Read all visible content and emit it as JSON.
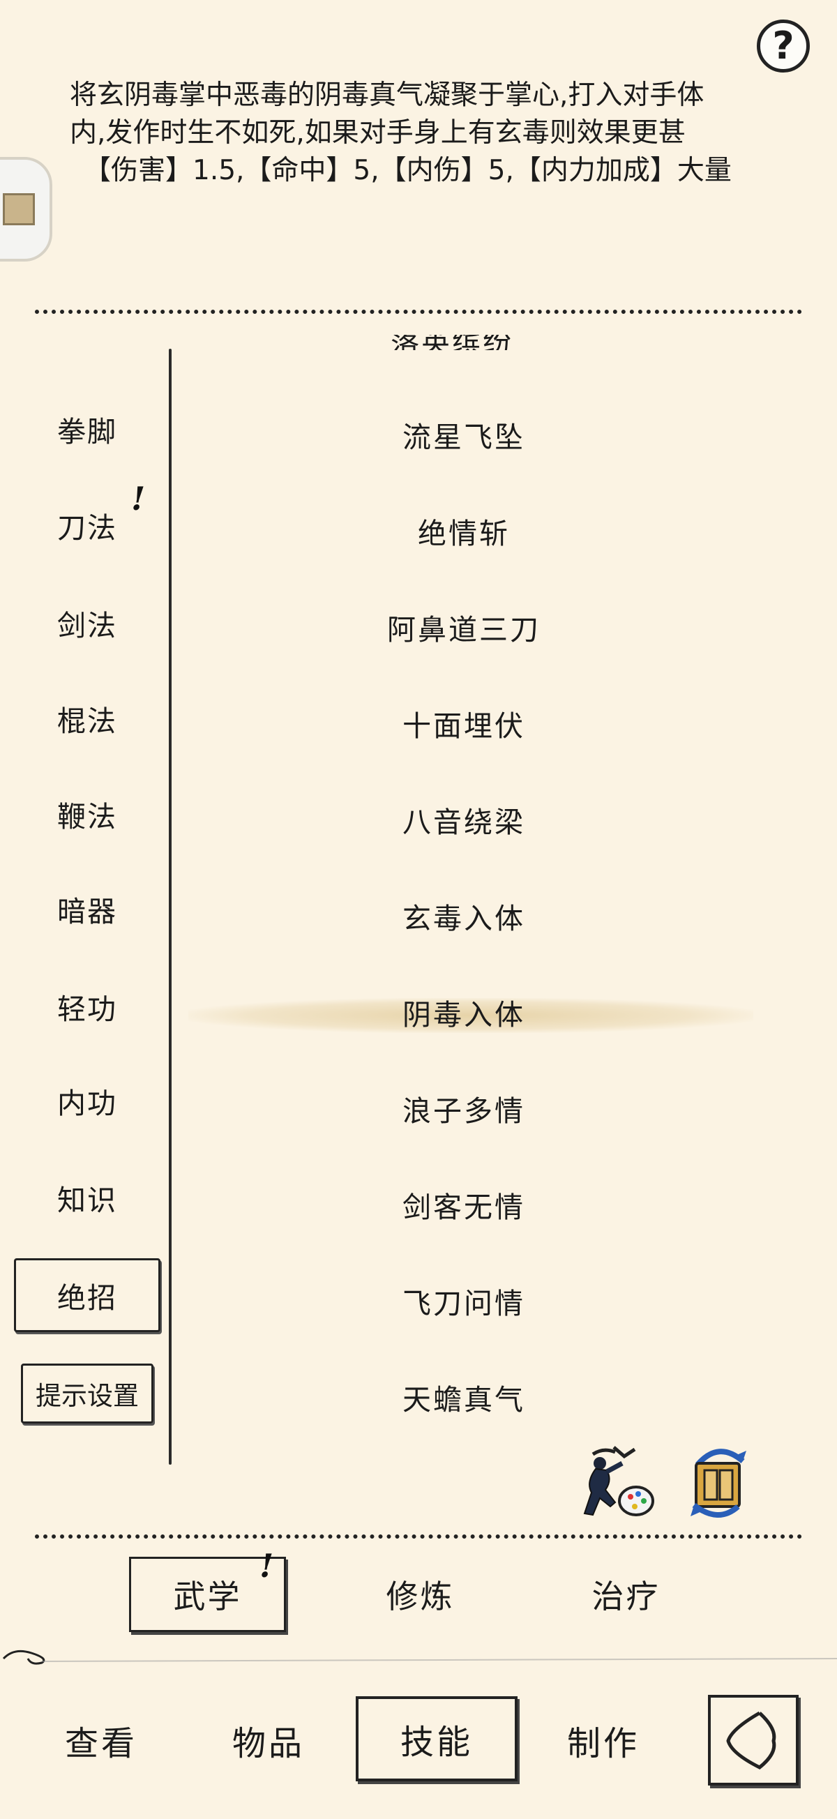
{
  "help": {
    "label": "?"
  },
  "description": {
    "line1": "将玄阴毒掌中恶毒的阴毒真气凝聚于掌心,打入对手体",
    "line2": "内,发作时生不如死,如果对手身上有玄毒则效果更甚",
    "stats": "【伤害】1.5,【命中】5,【内伤】5,【内力加成】大量"
  },
  "categories": [
    {
      "label": "拳脚"
    },
    {
      "label": "刀法",
      "badge": "!"
    },
    {
      "label": "剑法"
    },
    {
      "label": "棍法"
    },
    {
      "label": "鞭法"
    },
    {
      "label": "暗器"
    },
    {
      "label": "轻功"
    },
    {
      "label": "内功"
    },
    {
      "label": "知识"
    },
    {
      "label": "绝招"
    },
    {
      "label": "提示设置"
    }
  ],
  "skills": {
    "partial_top": "落英缤纷",
    "items": [
      {
        "label": "流星飞坠"
      },
      {
        "label": "绝情斩"
      },
      {
        "label": "阿鼻道三刀"
      },
      {
        "label": "十面埋伏"
      },
      {
        "label": "八音绕梁"
      },
      {
        "label": "玄毒入体"
      },
      {
        "label": "阴毒入体"
      },
      {
        "label": "浪子多情"
      },
      {
        "label": "剑客无情"
      },
      {
        "label": "飞刀问情"
      },
      {
        "label": "天蟾真气"
      }
    ]
  },
  "subtabs": [
    {
      "label": "武学",
      "badge": "!"
    },
    {
      "label": "修炼"
    },
    {
      "label": "治疗"
    }
  ],
  "nav": [
    {
      "label": "查看"
    },
    {
      "label": "物品"
    },
    {
      "label": "技能"
    },
    {
      "label": "制作"
    }
  ],
  "colors": {
    "background": "#fbf3e3",
    "text": "#1b1b1b",
    "selected_highlight": "#d6b978"
  }
}
